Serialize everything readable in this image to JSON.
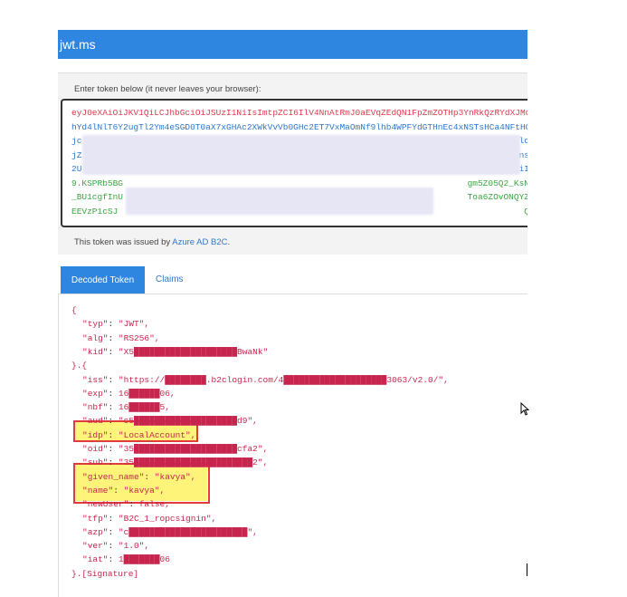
{
  "header": {
    "title": "jwt.ms"
  },
  "token_panel": {
    "hint": "Enter token below (it never leaves your browser):",
    "lines": [
      {
        "text": "eyJ0eXAiOiJKV1QiLCJhbGciOiJSUzI1NiIsImtpZCI6IlV4NnAtRmJ0aEVqZEdQN1FpZmZOTHp3YnRkQzRYdXJMdWIQ",
        "color": "red"
      },
      {
        "text": "hYd4lNlT6Y2ugTl2Ym4eSGD0T0aX7xGHAc2XWkVvVb0GHc2ET7VxMaOmNf9lhb4WPFYdGTHnEc4xNSTsHCa4NFtHC",
        "color": "blue"
      },
      {
        "text": "jc",
        "color": "blue",
        "tail": "lc"
      },
      {
        "text": "jZ",
        "color": "blue",
        "tail": "ns"
      },
      {
        "text": "2U",
        "color": "blue",
        "tail": "iI"
      },
      {
        "text": "9.KSPRb5BG",
        "color": "green",
        "tail": "gm5Z05Q2_KsN"
      },
      {
        "text": "_BU1cgfInU",
        "color": "green",
        "tail": "Toa6ZOvONQYZ"
      },
      {
        "text": "EEVzP1cSJ",
        "color": "green",
        "tail": "Q"
      }
    ],
    "issued_prefix": "This token was issued by ",
    "issued_link": "Azure AD B2C",
    "issued_suffix": "."
  },
  "tabs": {
    "decoded": "Decoded Token",
    "claims": "Claims"
  },
  "decoded": {
    "lines": [
      {
        "text": "{"
      },
      {
        "key": "typ",
        "value": "\"JWT\","
      },
      {
        "key": "alg",
        "value": "\"RS256\","
      },
      {
        "key": "kid",
        "value": "\"X5████████████████████BwaNk\""
      },
      {
        "text": "}.{"
      },
      {
        "key": "iss",
        "value": "\"https://████████.b2clogin.com/4████████████████████3063/v2.0/\","
      },
      {
        "key": "exp",
        "value": "16██████06,"
      },
      {
        "key": "nbf",
        "value": "16██████5,"
      },
      {
        "key": "aud",
        "value": "\"c5████████████████████d9\","
      },
      {
        "key": "idp",
        "value": "\"LocalAccount\","
      },
      {
        "key": "oid",
        "value": "\"35████████████████████cfa2\","
      },
      {
        "key": "sub",
        "value": "\"35███████████████████████2\","
      },
      {
        "key": "given_name",
        "value": "\"kavya\","
      },
      {
        "key": "name",
        "value": "\"kavya\","
      },
      {
        "key": "newUser",
        "value": "false,"
      },
      {
        "key": "tfp",
        "value": "\"B2C_1_ropcsignin\","
      },
      {
        "key": "azp",
        "value": "\"c███████████████████████\","
      },
      {
        "key": "ver",
        "value": "\"1.0\","
      },
      {
        "key": "iat",
        "value": "1███████06"
      },
      {
        "text": "}.[Signature]"
      }
    ]
  },
  "colors": {
    "accent": "#2f86e0",
    "highlight": "#fff47a",
    "annotation": "#e23b3b"
  }
}
